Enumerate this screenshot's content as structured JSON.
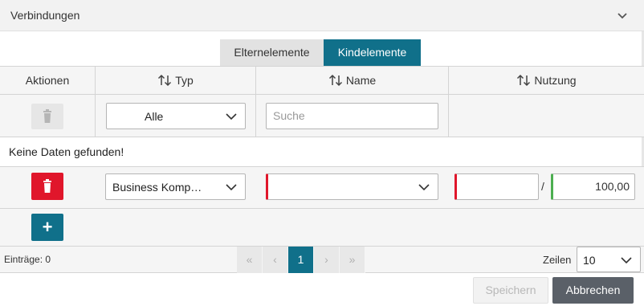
{
  "panel": {
    "title": "Verbindungen"
  },
  "tabs": [
    {
      "label": "Elternelemente",
      "active": false
    },
    {
      "label": "Kindelemente",
      "active": true
    }
  ],
  "columns": {
    "actions": "Aktionen",
    "type": "Typ",
    "name": "Name",
    "usage": "Nutzung"
  },
  "filter": {
    "type_value": "Alle",
    "name_placeholder": "Suche"
  },
  "no_data": "Keine Daten gefunden!",
  "edit_row": {
    "type_value": "Business Komp…",
    "name_value": "",
    "usage_value": "",
    "separator": "/",
    "usage_total": "100,00"
  },
  "add_label": "+",
  "footer": {
    "entries": "Einträge: 0",
    "pager": {
      "first": "«",
      "prev": "‹",
      "current": "1",
      "next": "›",
      "last": "»"
    },
    "rows_label": "Zeilen",
    "rows_value": "10"
  },
  "actions": {
    "save": "Speichern",
    "cancel": "Abbrechen"
  },
  "colors": {
    "accent": "#10708a",
    "danger": "#e0162b",
    "ok": "#4caf50"
  },
  "icons": [
    "chevron-down-icon",
    "sort-icon",
    "trash-icon",
    "plus-icon"
  ]
}
